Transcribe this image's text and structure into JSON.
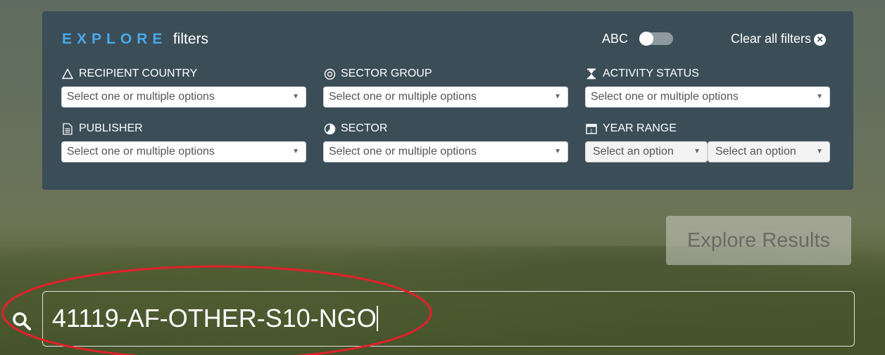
{
  "panel": {
    "title_explore": "EXPLORE",
    "title_filters": "filters",
    "abc_label": "ABC",
    "clear_label": "Clear all filters",
    "clear_icon": "x-circle-icon"
  },
  "filters": {
    "recipient_country": {
      "label": "RECIPIENT COUNTRY",
      "placeholder": "Select one or multiple options",
      "icon": "triangle-icon"
    },
    "sector_group": {
      "label": "SECTOR GROUP",
      "placeholder": "Select one or multiple options",
      "icon": "target-circle-icon"
    },
    "activity_status": {
      "label": "ACTIVITY STATUS",
      "placeholder": "Select one or multiple options",
      "icon": "hourglass-icon"
    },
    "publisher": {
      "label": "PUBLISHER",
      "placeholder": "Select one or multiple options",
      "icon": "document-icon"
    },
    "sector": {
      "label": "SECTOR",
      "placeholder": "Select one or multiple options",
      "icon": "pie-chart-icon"
    },
    "year_range": {
      "label": "YEAR RANGE",
      "from_placeholder": "Select an option",
      "to_placeholder": "Select an option",
      "icon": "calendar-icon"
    }
  },
  "explore_button": "Explore Results",
  "search": {
    "value": "41119-AF-OTHER-S10-NGO",
    "icon": "search-icon"
  },
  "colors": {
    "accent": "#47a9e8",
    "panel": "#3b4d57",
    "annotation": "#e3202a"
  }
}
